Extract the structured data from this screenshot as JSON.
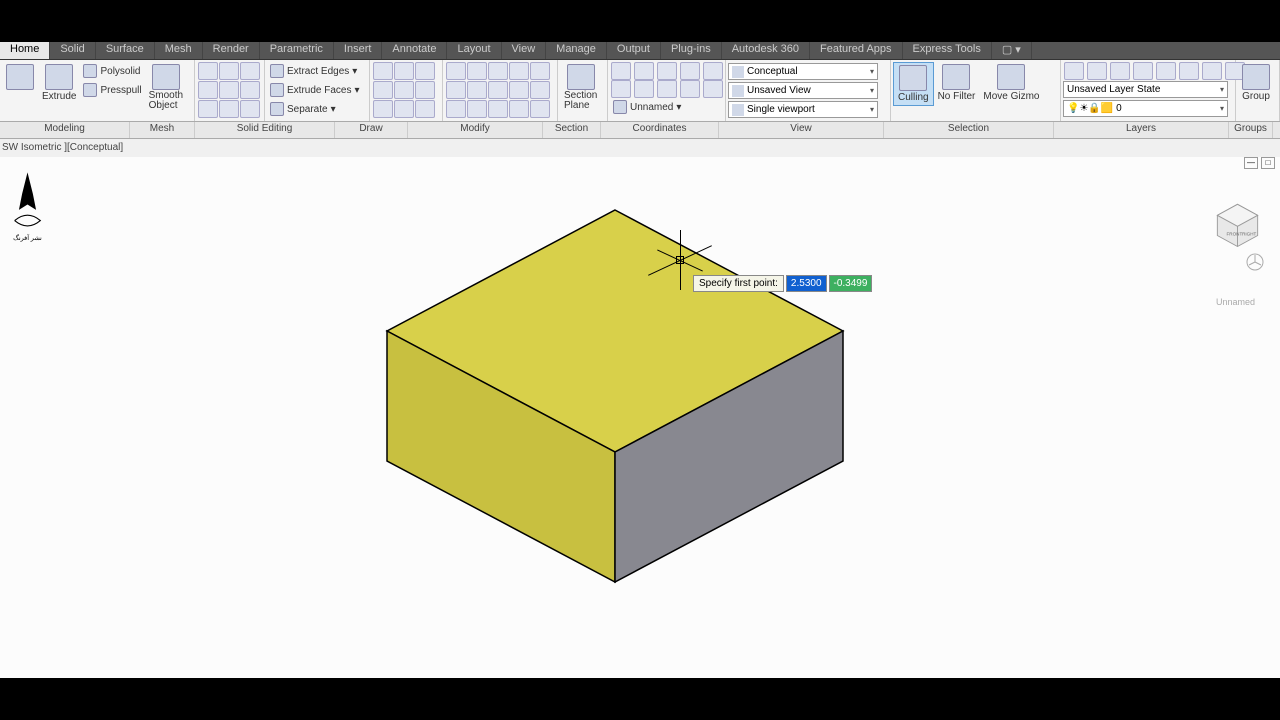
{
  "tabs": [
    "Home",
    "Solid",
    "Surface",
    "Mesh",
    "Render",
    "Parametric",
    "Insert",
    "Annotate",
    "Layout",
    "View",
    "Manage",
    "Output",
    "Plug-ins",
    "Autodesk 360",
    "Featured Apps",
    "Express Tools"
  ],
  "modeling": {
    "extrude": "Extrude",
    "polysolid": "Polysolid",
    "presspull": "Presspull",
    "smooth": "Smooth\nObject"
  },
  "solidEditing": {
    "extractEdges": "Extract Edges",
    "extrudeFaces": "Extrude Faces",
    "separate": "Separate"
  },
  "section": {
    "plane": "Section\nPlane"
  },
  "coords": {
    "unnamed": "Unnamed"
  },
  "viewPanel": {
    "conceptual": "Conceptual",
    "unsaved": "Unsaved View",
    "single": "Single viewport"
  },
  "selection": {
    "culling": "Culling",
    "nofilter": "No Filter",
    "movegizmo": "Move Gizmo"
  },
  "layers": {
    "state": "Unsaved Layer State",
    "current": "0"
  },
  "groups": {
    "group": "Group"
  },
  "panelTitles": {
    "modeling": "Modeling",
    "mesh": "Mesh",
    "solidEditing": "Solid Editing",
    "draw": "Draw",
    "modify": "Modify",
    "section": "Section",
    "coordinates": "Coordinates",
    "view": "View",
    "selection": "Selection",
    "layers": "Layers",
    "groups": "Groups"
  },
  "viewportLabel": "SW Isometric ][Conceptual]",
  "dynInput": {
    "prompt": "Specify first point:",
    "x": "2.5300",
    "y": "-0.3499"
  },
  "vcLabel": "Unnamed"
}
